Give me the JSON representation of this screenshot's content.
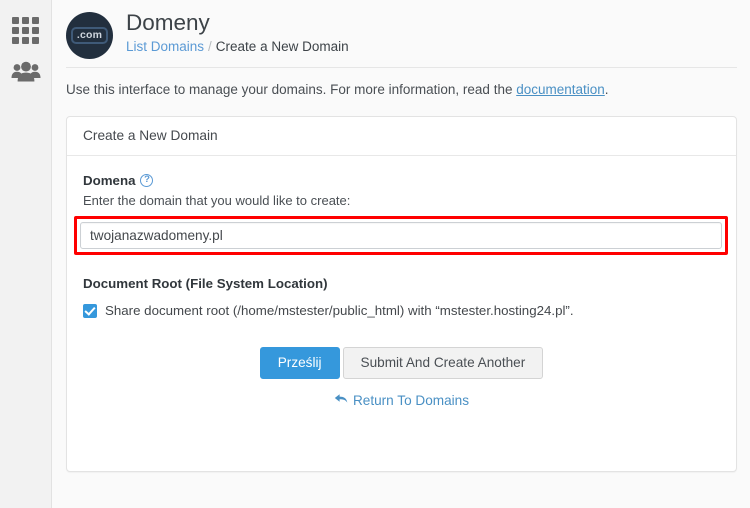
{
  "sidebar": {
    "items": [
      {
        "icon": "grid-apps-icon",
        "label": "Applications"
      },
      {
        "icon": "users-group-icon",
        "label": "Users"
      }
    ]
  },
  "header": {
    "logo_badge": ".com",
    "logo_icon": "domain-com-icon",
    "title": "Domeny",
    "breadcrumb": {
      "link_label": "List Domains",
      "separator": "/",
      "current_label": "Create a New Domain"
    }
  },
  "description": {
    "before_link": "Use this interface to manage your domains. For more information, read the ",
    "link_label": "documentation",
    "after_link": "."
  },
  "panel": {
    "heading": "Create a New Domain",
    "domain_field": {
      "label": "Domena",
      "help_icon": "question-mark-icon",
      "hint": "Enter the domain that you would like to create:",
      "value": "twojanazwadomeny.pl",
      "placeholder": ""
    },
    "document_root": {
      "label": "Document Root (File System Location)",
      "checkbox_checked": true,
      "checkbox_label": "Share document root (/home/mstester/public_html) with “mstester.hosting24.pl”."
    },
    "actions": {
      "submit_label": "Prześlij",
      "submit_another_label": "Submit And Create Another",
      "return_icon": "back-arrow-icon",
      "return_label": "Return To Domains"
    }
  },
  "colors": {
    "primary": "#3598dc",
    "link": "#4a90c4",
    "highlight_border": "#ff0000",
    "logo_bg": "#222f3e"
  }
}
